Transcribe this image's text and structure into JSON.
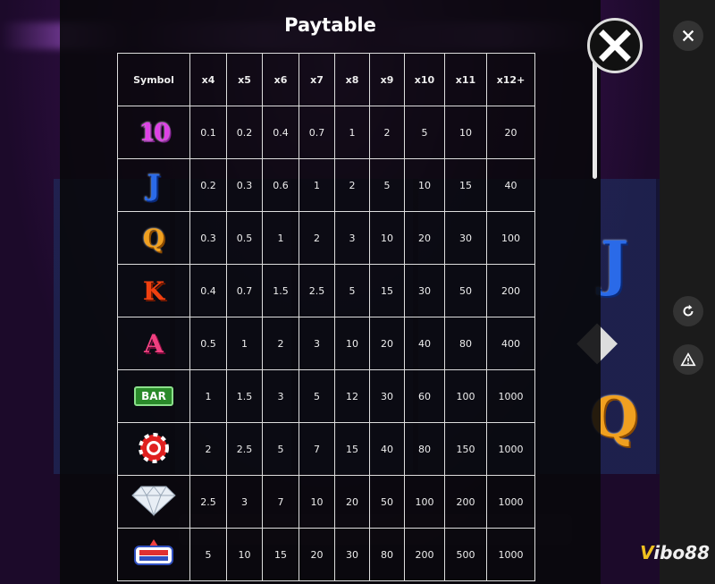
{
  "title": "Paytable",
  "columns": [
    "Symbol",
    "x4",
    "x5",
    "x6",
    "x7",
    "x8",
    "x9",
    "x10",
    "x11",
    "x12+"
  ],
  "rows": [
    {
      "symbol": "10-icon",
      "symbol_text": "10",
      "values": [
        "0.1",
        "0.2",
        "0.4",
        "0.7",
        "1",
        "2",
        "5",
        "10",
        "20"
      ]
    },
    {
      "symbol": "j-icon",
      "symbol_text": "J",
      "values": [
        "0.2",
        "0.3",
        "0.6",
        "1",
        "2",
        "5",
        "10",
        "15",
        "40"
      ]
    },
    {
      "symbol": "q-icon",
      "symbol_text": "Q",
      "values": [
        "0.3",
        "0.5",
        "1",
        "2",
        "3",
        "10",
        "20",
        "30",
        "100"
      ]
    },
    {
      "symbol": "k-icon",
      "symbol_text": "K",
      "values": [
        "0.4",
        "0.7",
        "1.5",
        "2.5",
        "5",
        "15",
        "30",
        "50",
        "200"
      ]
    },
    {
      "symbol": "a-icon",
      "symbol_text": "A",
      "values": [
        "0.5",
        "1",
        "2",
        "3",
        "10",
        "20",
        "40",
        "80",
        "400"
      ]
    },
    {
      "symbol": "bar-icon",
      "symbol_text": "BAR",
      "values": [
        "1",
        "1.5",
        "3",
        "5",
        "12",
        "30",
        "60",
        "100",
        "1000"
      ]
    },
    {
      "symbol": "chip-icon",
      "symbol_text": "",
      "values": [
        "2",
        "2.5",
        "5",
        "7",
        "15",
        "40",
        "80",
        "150",
        "1000"
      ]
    },
    {
      "symbol": "diamond-icon",
      "symbol_text": "",
      "values": [
        "2.5",
        "3",
        "7",
        "10",
        "20",
        "50",
        "100",
        "200",
        "1000"
      ]
    },
    {
      "symbol": "slots-money-logo-icon",
      "symbol_text": "",
      "values": [
        "5",
        "10",
        "15",
        "20",
        "30",
        "80",
        "200",
        "500",
        "1000"
      ]
    }
  ],
  "icons": {
    "close": "close-icon",
    "side_close": "close-icon",
    "reload": "refresh-icon",
    "warning": "warning-icon"
  },
  "colors": {
    "overlay": "#080808",
    "table_border": "#dddddd",
    "side_panel": "#1b1b1b"
  },
  "branding": {
    "watermark": "Vibo88"
  }
}
